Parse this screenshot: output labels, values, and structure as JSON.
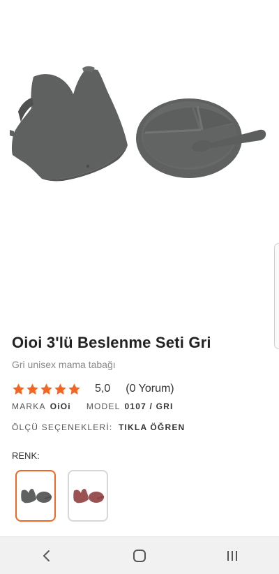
{
  "product": {
    "title": "Oioi 3'lü Beslenme Seti Gri",
    "subtitle": "Gri unisex mama tabağı",
    "rating_value": "5,0",
    "review_count": "(0 Yorum)",
    "stars": 5
  },
  "meta": {
    "brand_label": "MARKA",
    "brand_value": "OiOi",
    "model_label": "MODEL",
    "model_value": "0107 / GRI"
  },
  "size": {
    "label": "ÖLÇÜ SEÇENEKLERİ:",
    "link": "TIKLA ÖĞREN"
  },
  "color": {
    "label": "RENK:",
    "options": [
      {
        "name": "gray",
        "selected": true,
        "color": "#5f6060"
      },
      {
        "name": "red",
        "selected": false,
        "color": "#9a5252"
      }
    ]
  },
  "colors": {
    "accent": "#f26522",
    "star": "#f26522",
    "product_gray": "#5f6060"
  },
  "icons": {
    "back": "chevron-left-icon",
    "home": "home-icon",
    "recents": "recents-icon"
  }
}
